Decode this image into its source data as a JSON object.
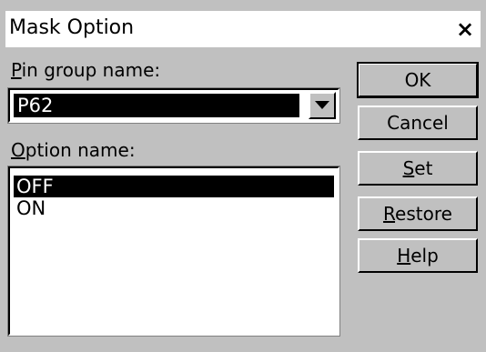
{
  "window": {
    "title": "Mask Option",
    "close_glyph": "×"
  },
  "pin_group": {
    "label_mnemonic": "P",
    "label_rest": "in group name:",
    "selected_value": "P62"
  },
  "option": {
    "label_mnemonic": "O",
    "label_rest": "ption name:",
    "items": [
      "OFF",
      "ON"
    ],
    "selected_index": 0
  },
  "buttons": {
    "ok": {
      "label": "OK"
    },
    "cancel": {
      "label": "Cancel"
    },
    "set": {
      "mnemonic": "S",
      "rest": "et"
    },
    "restore": {
      "mnemonic": "R",
      "rest": "estore"
    },
    "help": {
      "mnemonic": "H",
      "rest": "elp"
    }
  },
  "colors": {
    "face": "#c0c0c0",
    "selection": "#000000",
    "window": "#ffffff"
  }
}
